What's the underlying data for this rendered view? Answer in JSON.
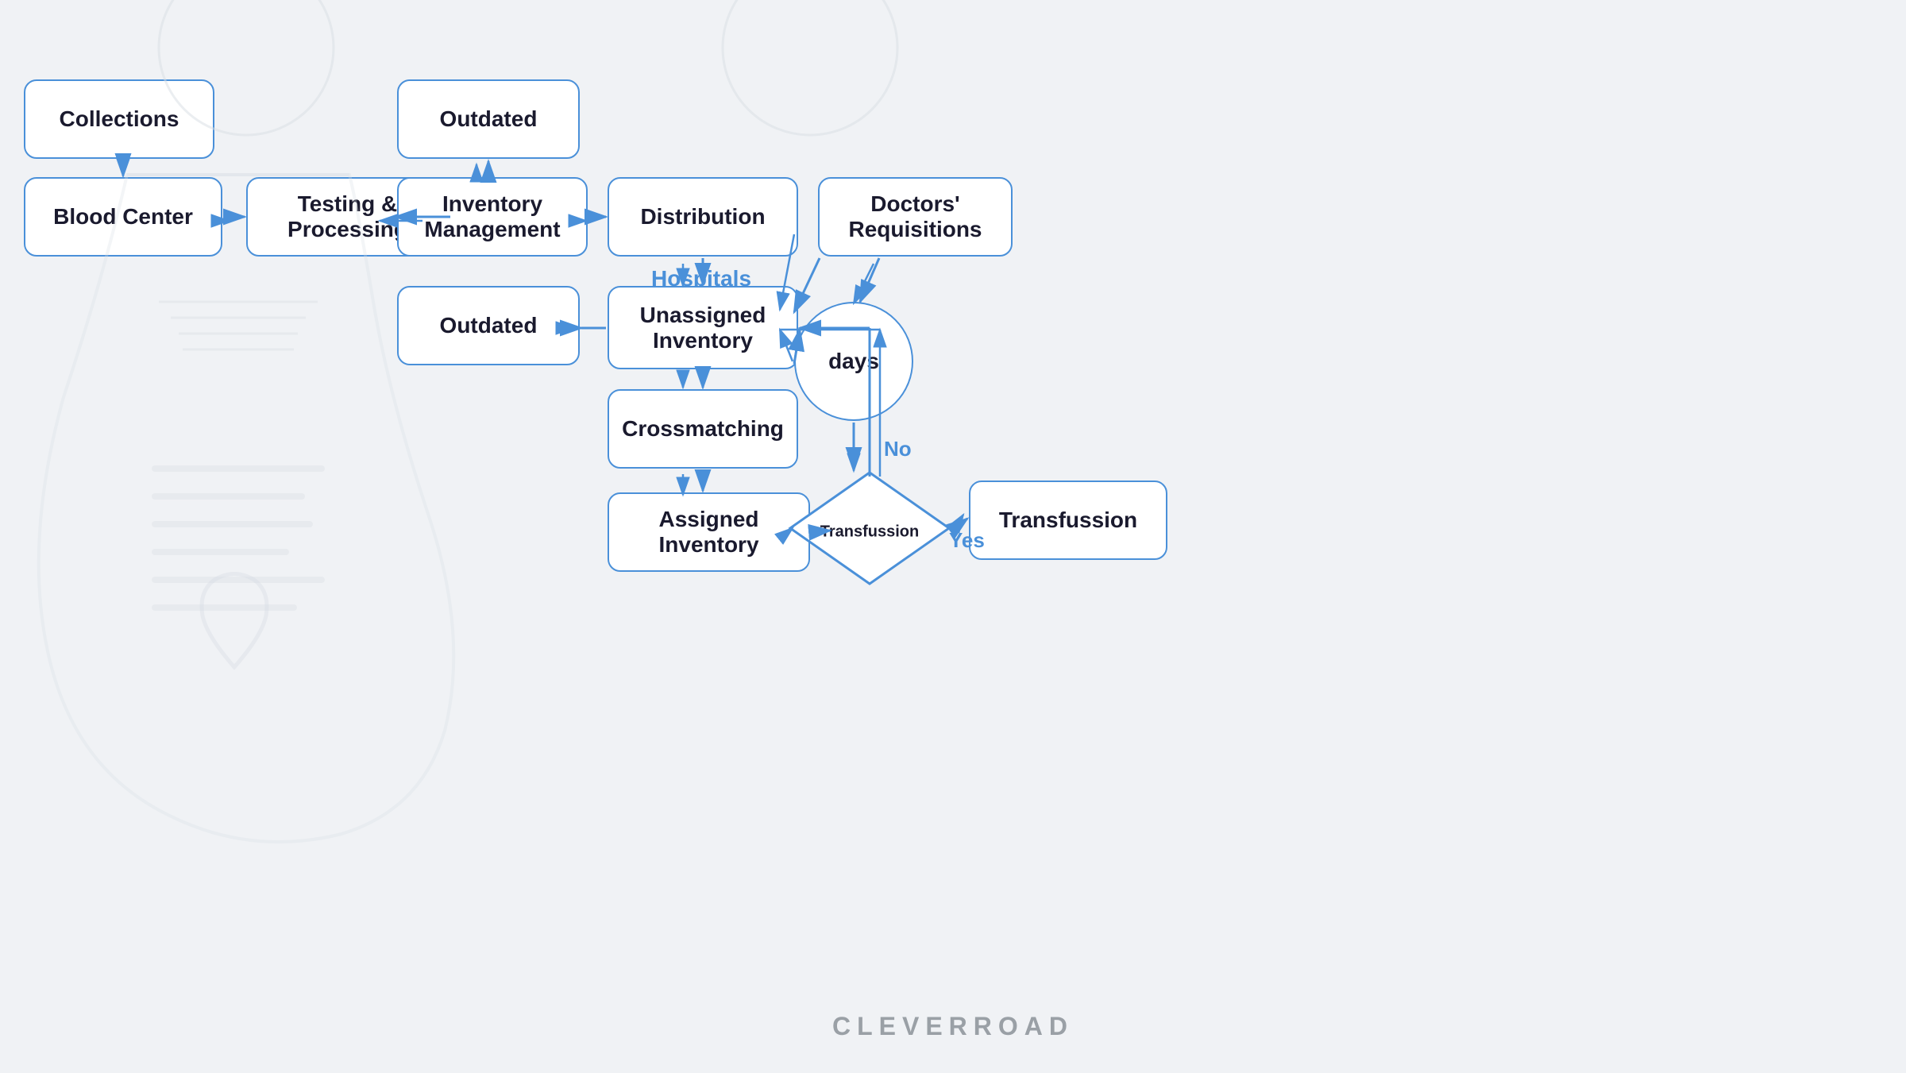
{
  "nodes": {
    "collections": "Collections",
    "blood_center": "Blood Center",
    "testing": "Testing &\nProcessing",
    "inventory_mgmt": "Inventory\nManagement",
    "outdated_top": "Outdated",
    "distribution": "Distribution",
    "doctors_req": "Doctors'\nRequisitions",
    "outdated_mid": "Outdated",
    "unassigned": "Unassigned\nInventory",
    "crossmatching": "Crossmatching",
    "assigned": "Assigned Inventory",
    "days": "days",
    "transfusion_diamond": "Transfussion",
    "transfusion_rect": "Transfussion"
  },
  "labels": {
    "hospitals": "Hospitals",
    "no": "No",
    "yes": "Yes"
  },
  "brand": "CLEVERROAD",
  "arrow_color": "#4a90d9"
}
